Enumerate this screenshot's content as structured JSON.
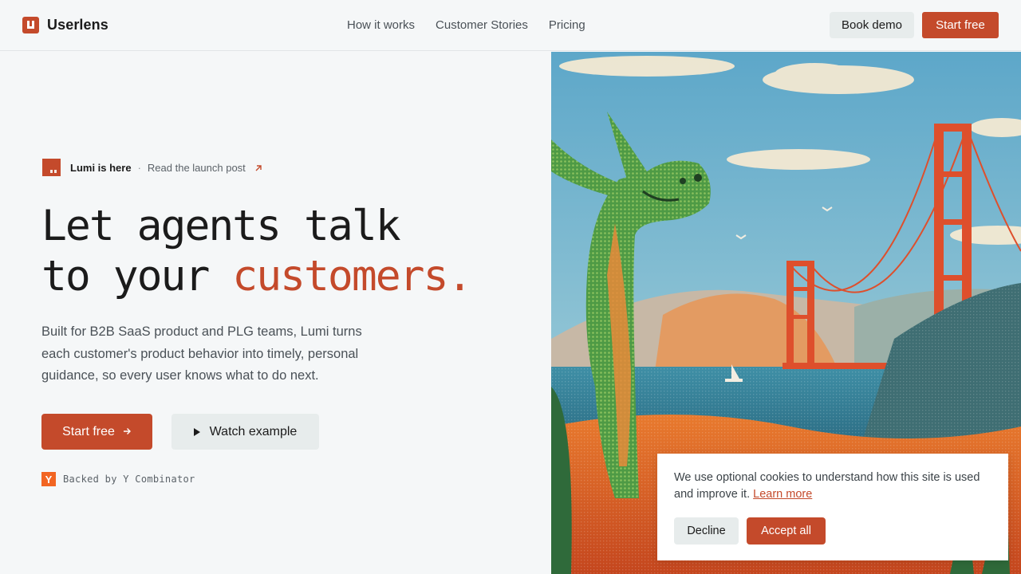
{
  "header": {
    "brand": "Userlens",
    "nav": [
      "How it works",
      "Customer Stories",
      "Pricing"
    ],
    "book_demo": "Book demo",
    "start_free": "Start free"
  },
  "hero": {
    "announcement": {
      "title": "Lumi is here",
      "separator": "·",
      "link": "Read the launch post",
      "icon": "arrow-up-right-icon"
    },
    "headline_line1": "Let agents talk",
    "headline_line2_prefix": "to your",
    "headline_line2_accent": "customers.",
    "subtitle": "Built for B2B SaaS product and PLG teams, Lumi turns each customer's product behavior into timely, personal guidance, so every user knows what to do next.",
    "cta_primary": "Start free",
    "cta_primary_icon": "arrow-right-icon",
    "cta_secondary": "Watch example",
    "cta_secondary_icon": "play-icon",
    "backed_logo": "Y",
    "backed_text": "Backed by Y Combinator"
  },
  "illustration": {
    "subject": "pixel-art dinosaur near Golden Gate Bridge"
  },
  "cookie_banner": {
    "text": "We use optional cookies to understand how this site is used and improve it.",
    "link": "Learn more",
    "decline": "Decline",
    "accept": "Accept all"
  },
  "colors": {
    "accent": "#c44a2b",
    "background": "#f5f7f8",
    "secondary_button": "#e7ecec",
    "yc_orange": "#f26522"
  }
}
